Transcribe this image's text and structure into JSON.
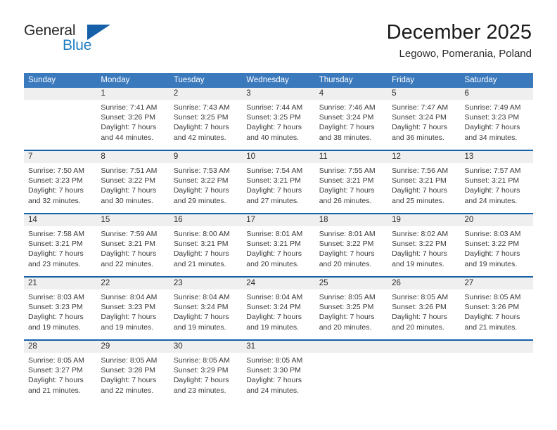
{
  "brand": {
    "name_part1": "General",
    "name_part2": "Blue",
    "logo_icon": "triangle-flag-icon"
  },
  "header": {
    "title": "December 2025",
    "subtitle": "Legowo, Pomerania, Poland"
  },
  "calendar": {
    "weekday_headers": [
      "Sunday",
      "Monday",
      "Tuesday",
      "Wednesday",
      "Thursday",
      "Friday",
      "Saturday"
    ],
    "accent_header_color": "#3b79bd",
    "week_rule_color": "#1560a8",
    "daynum_band_color": "#efefef",
    "weeks": [
      [
        {
          "day": "",
          "lines": []
        },
        {
          "day": "1",
          "lines": [
            "Sunrise: 7:41 AM",
            "Sunset: 3:26 PM",
            "Daylight: 7 hours",
            "and 44 minutes."
          ]
        },
        {
          "day": "2",
          "lines": [
            "Sunrise: 7:43 AM",
            "Sunset: 3:25 PM",
            "Daylight: 7 hours",
            "and 42 minutes."
          ]
        },
        {
          "day": "3",
          "lines": [
            "Sunrise: 7:44 AM",
            "Sunset: 3:25 PM",
            "Daylight: 7 hours",
            "and 40 minutes."
          ]
        },
        {
          "day": "4",
          "lines": [
            "Sunrise: 7:46 AM",
            "Sunset: 3:24 PM",
            "Daylight: 7 hours",
            "and 38 minutes."
          ]
        },
        {
          "day": "5",
          "lines": [
            "Sunrise: 7:47 AM",
            "Sunset: 3:24 PM",
            "Daylight: 7 hours",
            "and 36 minutes."
          ]
        },
        {
          "day": "6",
          "lines": [
            "Sunrise: 7:49 AM",
            "Sunset: 3:23 PM",
            "Daylight: 7 hours",
            "and 34 minutes."
          ]
        }
      ],
      [
        {
          "day": "7",
          "lines": [
            "Sunrise: 7:50 AM",
            "Sunset: 3:23 PM",
            "Daylight: 7 hours",
            "and 32 minutes."
          ]
        },
        {
          "day": "8",
          "lines": [
            "Sunrise: 7:51 AM",
            "Sunset: 3:22 PM",
            "Daylight: 7 hours",
            "and 30 minutes."
          ]
        },
        {
          "day": "9",
          "lines": [
            "Sunrise: 7:53 AM",
            "Sunset: 3:22 PM",
            "Daylight: 7 hours",
            "and 29 minutes."
          ]
        },
        {
          "day": "10",
          "lines": [
            "Sunrise: 7:54 AM",
            "Sunset: 3:21 PM",
            "Daylight: 7 hours",
            "and 27 minutes."
          ]
        },
        {
          "day": "11",
          "lines": [
            "Sunrise: 7:55 AM",
            "Sunset: 3:21 PM",
            "Daylight: 7 hours",
            "and 26 minutes."
          ]
        },
        {
          "day": "12",
          "lines": [
            "Sunrise: 7:56 AM",
            "Sunset: 3:21 PM",
            "Daylight: 7 hours",
            "and 25 minutes."
          ]
        },
        {
          "day": "13",
          "lines": [
            "Sunrise: 7:57 AM",
            "Sunset: 3:21 PM",
            "Daylight: 7 hours",
            "and 24 minutes."
          ]
        }
      ],
      [
        {
          "day": "14",
          "lines": [
            "Sunrise: 7:58 AM",
            "Sunset: 3:21 PM",
            "Daylight: 7 hours",
            "and 23 minutes."
          ]
        },
        {
          "day": "15",
          "lines": [
            "Sunrise: 7:59 AM",
            "Sunset: 3:21 PM",
            "Daylight: 7 hours",
            "and 22 minutes."
          ]
        },
        {
          "day": "16",
          "lines": [
            "Sunrise: 8:00 AM",
            "Sunset: 3:21 PM",
            "Daylight: 7 hours",
            "and 21 minutes."
          ]
        },
        {
          "day": "17",
          "lines": [
            "Sunrise: 8:01 AM",
            "Sunset: 3:21 PM",
            "Daylight: 7 hours",
            "and 20 minutes."
          ]
        },
        {
          "day": "18",
          "lines": [
            "Sunrise: 8:01 AM",
            "Sunset: 3:22 PM",
            "Daylight: 7 hours",
            "and 20 minutes."
          ]
        },
        {
          "day": "19",
          "lines": [
            "Sunrise: 8:02 AM",
            "Sunset: 3:22 PM",
            "Daylight: 7 hours",
            "and 19 minutes."
          ]
        },
        {
          "day": "20",
          "lines": [
            "Sunrise: 8:03 AM",
            "Sunset: 3:22 PM",
            "Daylight: 7 hours",
            "and 19 minutes."
          ]
        }
      ],
      [
        {
          "day": "21",
          "lines": [
            "Sunrise: 8:03 AM",
            "Sunset: 3:23 PM",
            "Daylight: 7 hours",
            "and 19 minutes."
          ]
        },
        {
          "day": "22",
          "lines": [
            "Sunrise: 8:04 AM",
            "Sunset: 3:23 PM",
            "Daylight: 7 hours",
            "and 19 minutes."
          ]
        },
        {
          "day": "23",
          "lines": [
            "Sunrise: 8:04 AM",
            "Sunset: 3:24 PM",
            "Daylight: 7 hours",
            "and 19 minutes."
          ]
        },
        {
          "day": "24",
          "lines": [
            "Sunrise: 8:04 AM",
            "Sunset: 3:24 PM",
            "Daylight: 7 hours",
            "and 19 minutes."
          ]
        },
        {
          "day": "25",
          "lines": [
            "Sunrise: 8:05 AM",
            "Sunset: 3:25 PM",
            "Daylight: 7 hours",
            "and 20 minutes."
          ]
        },
        {
          "day": "26",
          "lines": [
            "Sunrise: 8:05 AM",
            "Sunset: 3:26 PM",
            "Daylight: 7 hours",
            "and 20 minutes."
          ]
        },
        {
          "day": "27",
          "lines": [
            "Sunrise: 8:05 AM",
            "Sunset: 3:26 PM",
            "Daylight: 7 hours",
            "and 21 minutes."
          ]
        }
      ],
      [
        {
          "day": "28",
          "lines": [
            "Sunrise: 8:05 AM",
            "Sunset: 3:27 PM",
            "Daylight: 7 hours",
            "and 21 minutes."
          ]
        },
        {
          "day": "29",
          "lines": [
            "Sunrise: 8:05 AM",
            "Sunset: 3:28 PM",
            "Daylight: 7 hours",
            "and 22 minutes."
          ]
        },
        {
          "day": "30",
          "lines": [
            "Sunrise: 8:05 AM",
            "Sunset: 3:29 PM",
            "Daylight: 7 hours",
            "and 23 minutes."
          ]
        },
        {
          "day": "31",
          "lines": [
            "Sunrise: 8:05 AM",
            "Sunset: 3:30 PM",
            "Daylight: 7 hours",
            "and 24 minutes."
          ]
        },
        {
          "day": "",
          "lines": []
        },
        {
          "day": "",
          "lines": []
        },
        {
          "day": "",
          "lines": []
        }
      ]
    ]
  }
}
